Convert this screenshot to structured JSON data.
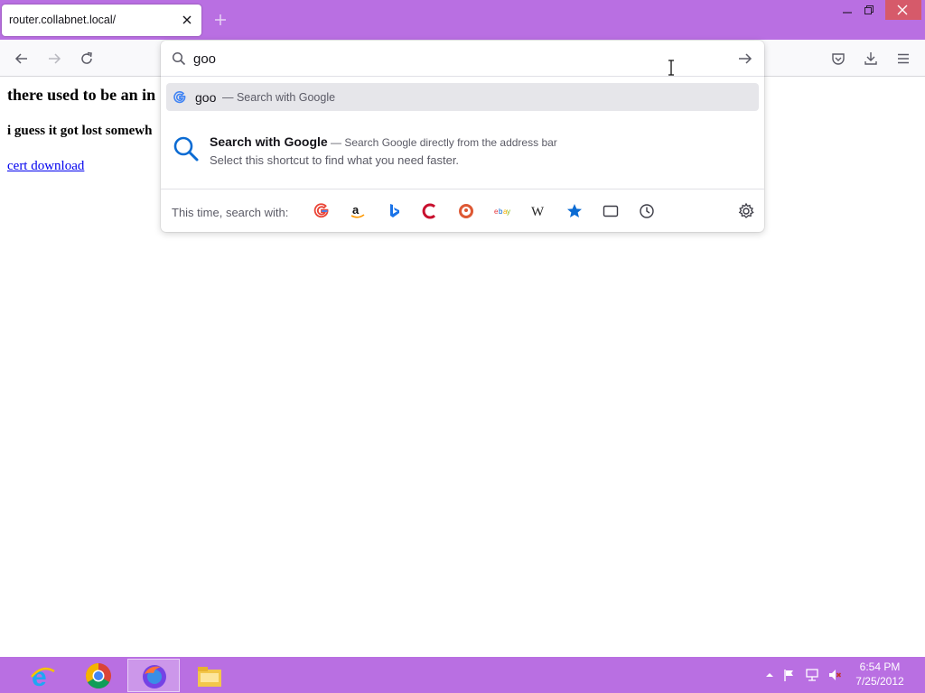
{
  "browser": {
    "tab": {
      "title": "router.collabnet.local/"
    },
    "window_controls": [
      "minimize",
      "restore",
      "close"
    ]
  },
  "page": {
    "heading": "there used to be an in",
    "subheading": "i guess it got lost somewh",
    "link": "cert download"
  },
  "urlbar": {
    "value": "goo",
    "results": {
      "search_row": {
        "query": "goo",
        "action": "— Search with Google"
      },
      "tip": {
        "title": "Search with Google",
        "title_suffix": "— Search Google directly from the address bar",
        "description": "Select this shortcut to find what you need faster."
      }
    },
    "one_offs": {
      "label": "This time, search with:",
      "engines": [
        "google-icon",
        "amazon-icon",
        "bing-icon",
        "cheapflights-icon",
        "duckduckgo-icon",
        "ebay-icon",
        "wikipedia-icon",
        "bookmarks-icon",
        "tabs-icon",
        "history-icon"
      ],
      "settings": "settings-gear-icon"
    }
  },
  "taskbar": {
    "apps": [
      "internet-explorer-icon",
      "chrome-icon",
      "firefox-icon",
      "file-explorer-icon"
    ],
    "clock": {
      "time": "6:54 PM",
      "date": "7/25/2012"
    }
  },
  "colors": {
    "accent": "#b96fe2",
    "link": "#0000ee",
    "highlight_row": "#e6e6ea",
    "close_button": "#d65a6a"
  }
}
